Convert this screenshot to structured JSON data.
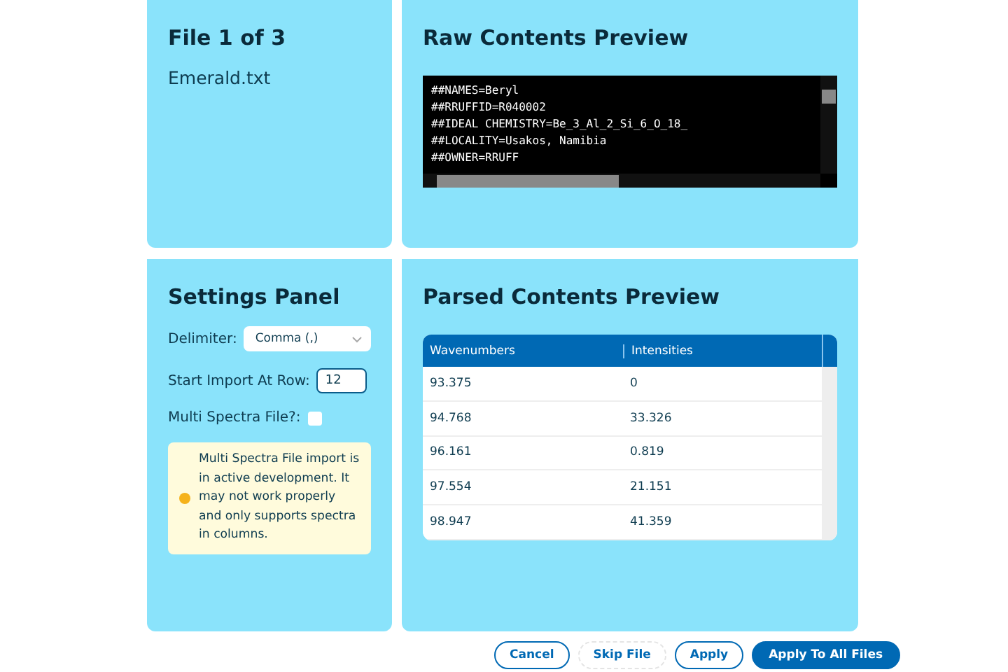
{
  "file_panel": {
    "title": "File 1 of 3",
    "file_name": "Emerald.txt"
  },
  "raw_preview": {
    "title": "Raw Contents Preview",
    "lines": [
      "##NAMES=Beryl",
      "##RRUFFID=R040002",
      "##IDEAL CHEMISTRY=Be_3_Al_2_Si_6_O_18_",
      "##LOCALITY=Usakos, Namibia",
      "##OWNER=RRUFF"
    ]
  },
  "settings": {
    "title": "Settings Panel",
    "delimiter": {
      "label": "Delimiter:",
      "value": "Comma (,)"
    },
    "start_row": {
      "label": "Start Import At Row:",
      "value": "12"
    },
    "multi_spectra": {
      "label": "Multi Spectra File?:",
      "checked": false
    },
    "warning": {
      "text": "Multi Spectra File import is in active development. It may not work properly and only supports spectra in columns.",
      "color": "#f5b21b"
    }
  },
  "parsed_preview": {
    "title": "Parsed Contents Preview",
    "columns": [
      "Wavenumbers",
      "Intensities"
    ],
    "rows": [
      [
        "93.375",
        "0"
      ],
      [
        "94.768",
        "33.326"
      ],
      [
        "96.161",
        "0.819"
      ],
      [
        "97.554",
        "21.151"
      ],
      [
        "98.947",
        "41.359"
      ]
    ]
  },
  "buttons": [
    {
      "label": "Cancel",
      "kind": "outline"
    },
    {
      "label": "Skip File",
      "kind": "ghost"
    },
    {
      "label": "Apply",
      "kind": "outline"
    },
    {
      "label": "Apply To All Files",
      "kind": "primary"
    }
  ]
}
